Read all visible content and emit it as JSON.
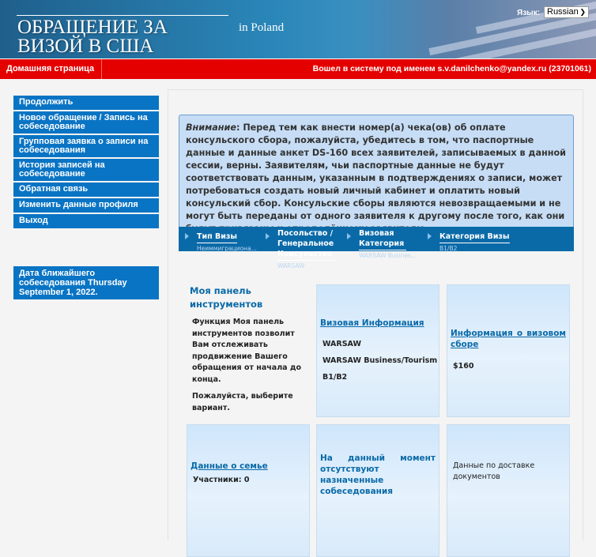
{
  "header": {
    "title_line1": "ОБРАЩЕНИЕ ЗА",
    "title_line2": "ВИЗОЙ В США",
    "country": "in  Poland",
    "language_label": "Язык:",
    "language_value": "Russian"
  },
  "topbar": {
    "home": "Домашняя страница",
    "user": "Вошел в систему под именем  s.v.danilchenko@yandex.ru (23701061)"
  },
  "nav": {
    "items": [
      {
        "label": "Продолжить"
      },
      {
        "label": "Новое обращение / Запись на собеседование"
      },
      {
        "label": "Групповая заявка о записи на собеседования"
      },
      {
        "label": "История записей на собеседование"
      },
      {
        "label": "Обратная связь"
      },
      {
        "label": "Изменить данные профиля"
      },
      {
        "label": "Выход"
      }
    ]
  },
  "next_interview": "Дата ближайшего собеседования Thursday September 1, 2022.",
  "notice": {
    "lead": "Внимание",
    "text": ": Перед тем как внести номер(а) чека(ов) об оплате консульского сбора, пожалуйста, убедитесь в том, что паспортные данные и данные анкет DS-160 всех заявителей, записываемых в данной сессии, верны. Заявителям, чьи паспортные данные не будут соответствовать данным, указанным в подтверждениях о записи, может потребоваться создать новый личный кабинет и оплатить новый консульский сбор. Консульские сборы являются невозвращаемыми и не могут быть переданы от одного заявителя к другому после того, как они будут привязаны к определённому заявителю."
  },
  "steps": [
    {
      "label": "Тип Визы",
      "value": "Неиммиграциона..."
    },
    {
      "label": "Посольство / Генеральное Консульство",
      "value": "WARSAW"
    },
    {
      "label": "Визовая Категория",
      "value": "WARSAW Busines..."
    },
    {
      "label": "Категория Визы",
      "value": "B1/B2"
    }
  ],
  "dashboard": {
    "title": "Моя панель инструментов",
    "desc": "Функция Моя панель инструментов позволит Вам отслеживать продвижение Вашего обращения от начала до конца.",
    "prompt": "Пожалуйста, выберите вариант."
  },
  "visa_info": {
    "title": "Визовая Информация",
    "post": "WARSAW",
    "category": "WARSAW Business/Tourism",
    "class": "B1/B2"
  },
  "fee_info": {
    "title": "Информация о визовом сборе",
    "amount": "$160"
  },
  "family": {
    "title": "Данные о семье",
    "participants": "Участники: 0"
  },
  "appointments": {
    "text": "На данный момент отсутствуют назначенные собеседования"
  },
  "delivery": {
    "text": "Данные по доставке документов"
  }
}
